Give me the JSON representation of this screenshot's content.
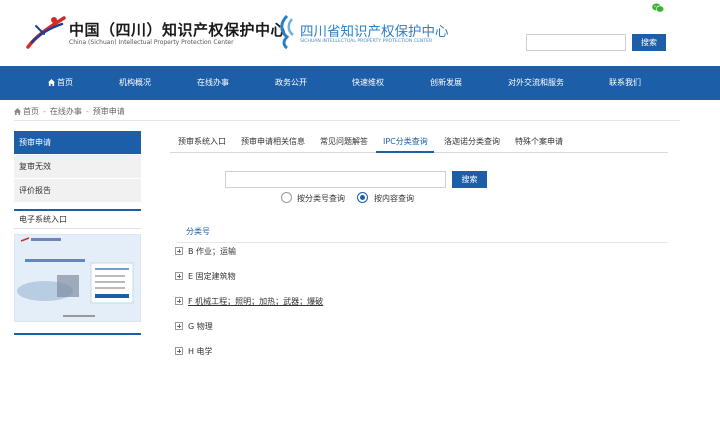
{
  "header": {
    "org1_title": "中国（四川）知识产权保护中心",
    "org1_subtitle": "China (Sichuan) Intellectual Property Protection Center",
    "org2_title": "四川省知识产权保护中心",
    "org2_subtitle": "SICHUAN INTELLECTUAL PROPERTY PROTECTION CENTER",
    "search_button": "搜索",
    "search_placeholder": ""
  },
  "nav": {
    "items": [
      "首页",
      "机构概况",
      "在线办事",
      "政务公开",
      "快速维权",
      "创新发展",
      "对外交流和服务",
      "联系我们"
    ]
  },
  "breadcrumb": [
    "首页",
    "在线办事",
    "预审申请"
  ],
  "sidebar": {
    "items": [
      "预审申请",
      "复审无效",
      "评价报告"
    ],
    "active_index": 0,
    "section_title": "电子系统入口"
  },
  "tabs": {
    "items": [
      "预审系统入口",
      "预审申请相关信息",
      "常见问题解答",
      "IPC分类查询",
      "洛迦诺分类查询",
      "特殊个案申请"
    ],
    "active_index": 3
  },
  "ipc_search": {
    "input_value": "",
    "button": "搜索",
    "radio_options": [
      "按分类号查询",
      "按内容查询"
    ],
    "selected_radio": 1
  },
  "classification": {
    "header": "分类号",
    "items": [
      "B 作业；运输",
      "E 固定建筑物",
      "F 机械工程；照明；加热；武器；爆破",
      "G 物理",
      "H 电学"
    ]
  },
  "colors": {
    "primary": "#1c5ea8",
    "logo_red": "#d42a2a",
    "logo_light_blue": "#2a7fc6",
    "wechat_green": "#3cb034"
  }
}
